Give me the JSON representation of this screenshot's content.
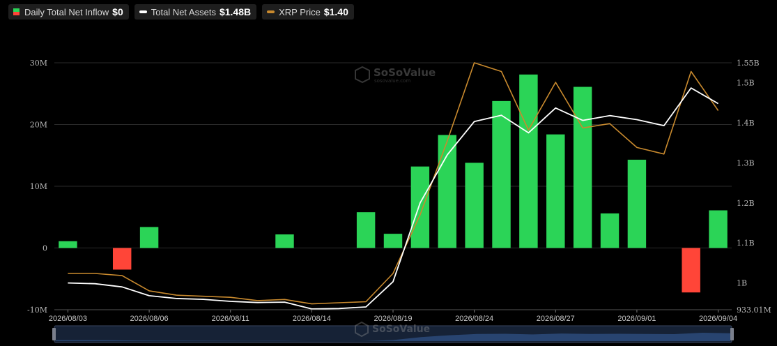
{
  "legend": {
    "inflow": {
      "label": "Daily Total Net Inflow",
      "value": "$0",
      "pos_color": "#2bd457",
      "neg_color": "#ff4538"
    },
    "assets": {
      "label": "Total Net Assets",
      "value": "$1.48B",
      "color": "#ffffff"
    },
    "price": {
      "label": "XRP Price",
      "value": "$1.40",
      "color": "#c98a2e"
    }
  },
  "watermark": {
    "brand": "SoSoValue",
    "url": "sosovalue.com"
  },
  "chart_data": {
    "type": "bar",
    "categories": [
      "2026/08/03",
      "2026/08/04",
      "2026/08/05",
      "2026/08/06",
      "2026/08/07",
      "2026/08/10",
      "2026/08/11",
      "2026/08/12",
      "2026/08/13",
      "2026/08/14",
      "2026/08/17",
      "2026/08/18",
      "2026/08/19",
      "2026/08/20",
      "2026/08/21",
      "2026/08/24",
      "2026/08/25",
      "2026/08/26",
      "2026/08/27",
      "2026/08/28",
      "2026/08/31",
      "2026/09/01",
      "2026/09/02",
      "2026/09/03",
      "2026/09/04"
    ],
    "x_tick_labels": [
      "2026/08/03",
      "2026/08/06",
      "2026/08/11",
      "2026/08/14",
      "2026/08/19",
      "2026/08/24",
      "2026/08/27",
      "2026/09/01",
      "2026/09/04"
    ],
    "x_tick_index": [
      0,
      3,
      6,
      9,
      12,
      15,
      18,
      21,
      24
    ],
    "y_left": {
      "ticks": [
        -10000000,
        0,
        10000000,
        20000000,
        30000000
      ],
      "tick_labels": [
        "-10M",
        "0",
        "10M",
        "20M",
        "30M"
      ],
      "lim": [
        -10000000,
        30000000
      ]
    },
    "y_right": {
      "ticks": [
        933010000,
        1000000000,
        1100000000,
        1200000000,
        1300000000,
        1400000000,
        1500000000,
        1550000000
      ],
      "tick_labels": [
        "933.01M",
        "1B",
        "1.1B",
        "1.2B",
        "1.3B",
        "1.4B",
        "1.5B",
        "1.55B"
      ],
      "lim": [
        933010000,
        1550000000
      ]
    },
    "grid": true,
    "series": [
      {
        "name": "Daily Total Net Inflow",
        "kind": "bar",
        "axis": "left",
        "values": [
          1100000,
          0,
          -3500000,
          3400000,
          0,
          0,
          0,
          0,
          2200000,
          0,
          0,
          5800000,
          2300000,
          13200000,
          18300000,
          13800000,
          23800000,
          28100000,
          18400000,
          26100000,
          5600000,
          14300000,
          0,
          -7200000,
          6100000
        ]
      },
      {
        "name": "Total Net Assets",
        "kind": "line",
        "axis": "right",
        "color": "#ffffff",
        "values": [
          1000000000,
          998000000,
          990000000,
          968000000,
          961000000,
          959000000,
          954000000,
          951000000,
          952000000,
          935000000,
          936000000,
          940000000,
          1003000000,
          1200000000,
          1320000000,
          1403000000,
          1419000000,
          1375000000,
          1437000000,
          1406000000,
          1418000000,
          1408000000,
          1393000000,
          1487000000,
          1448000000
        ]
      },
      {
        "name": "XRP Price",
        "kind": "line",
        "axis": "right",
        "color": "#c98a2e",
        "values": [
          1.34,
          1.34,
          1.33,
          1.26,
          1.24,
          1.235,
          1.23,
          1.215,
          1.22,
          1.2,
          1.205,
          1.21,
          1.34,
          1.61,
          1.95,
          2.31,
          2.27,
          2.0,
          2.22,
          2.01,
          2.03,
          1.92,
          1.89,
          2.27,
          2.09
        ],
        "price_range_hint": [
          1.195,
          2.31
        ]
      }
    ]
  }
}
